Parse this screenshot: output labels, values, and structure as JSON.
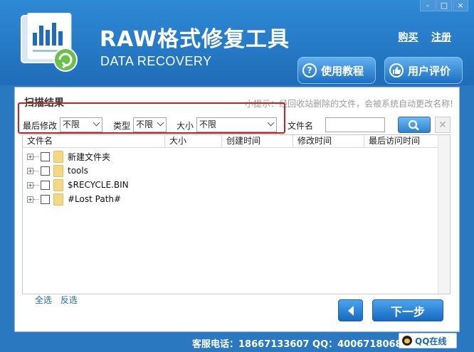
{
  "header": {
    "title": "RAW格式修复工具",
    "subtitle": "DATA RECOVERY",
    "links": {
      "buy": "购买",
      "register": "注册"
    },
    "window_controls": {
      "minimize": "-",
      "restore": "□",
      "close": "×"
    },
    "buttons": {
      "tutorial": "使用教程",
      "review": "用户评价"
    }
  },
  "scan": {
    "section_title": "扫描结果",
    "tip": "小提示：经回收站删除的文件，会被系统自动更改名称!",
    "filters": {
      "modified_label": "最后修改",
      "modified_value": "不限",
      "type_label": "类型",
      "type_value": "不限",
      "size_label": "大小",
      "size_value": "不限",
      "filename_label": "文件名",
      "filename_value": ""
    }
  },
  "table": {
    "columns": [
      "文件名",
      "大小",
      "创建时间",
      "修改时间",
      "最后访问时间"
    ],
    "rows": [
      {
        "name": "新建文件夹"
      },
      {
        "name": "tools"
      },
      {
        "name": "$RECYCLE.BIN"
      },
      {
        "name": "#Lost Path#"
      }
    ]
  },
  "selection": {
    "select_all": "全选",
    "invert": "反选"
  },
  "nav": {
    "next": "下一步"
  },
  "footer": {
    "contact": "客服电话：18667133607  QQ：4006718068",
    "qq_online": "QQ在线"
  },
  "colors": {
    "brand_blue": "#2a78c0",
    "highlight_red": "#c92020",
    "folder_yellow": "#f5d885"
  }
}
